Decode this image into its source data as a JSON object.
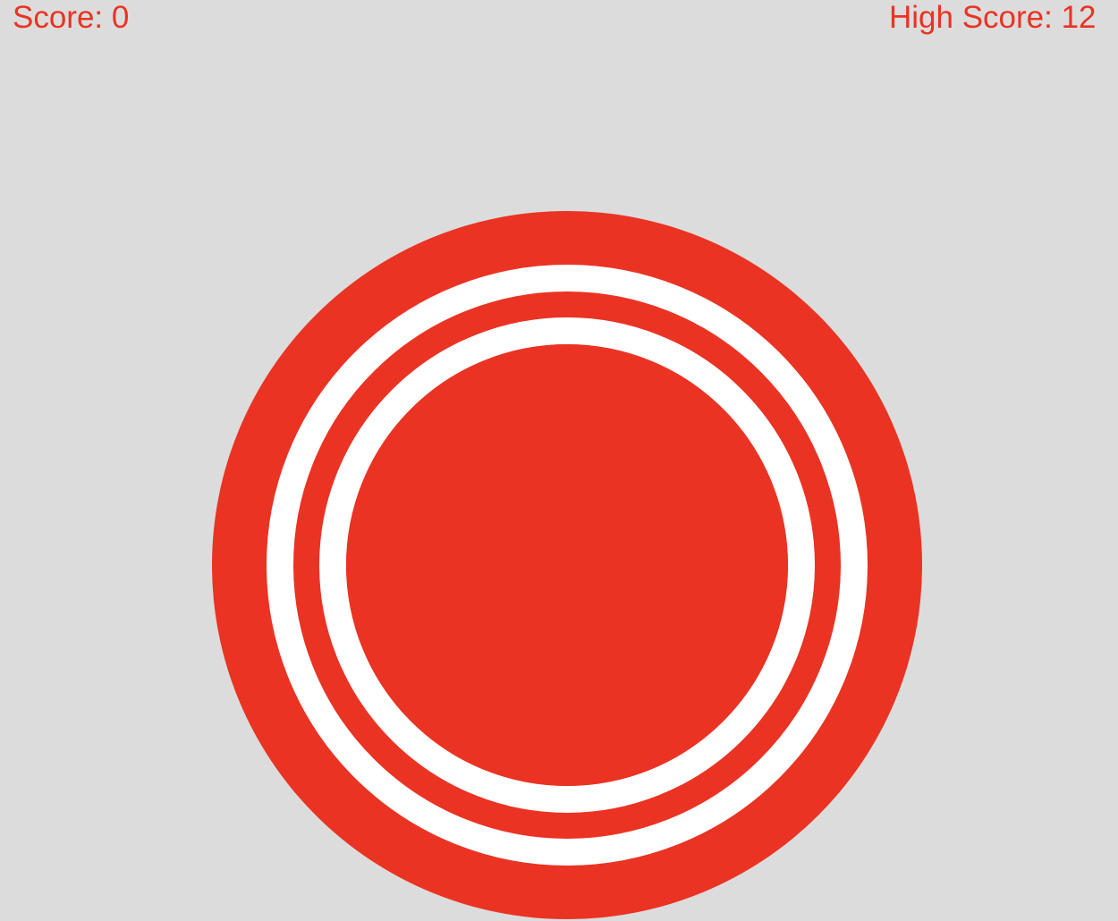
{
  "hud": {
    "score_label": "Score: 0",
    "high_score_label": "High Score: 12"
  },
  "colors": {
    "background": "#dcdcdc",
    "accent": "#ea3323",
    "ring": "#ffffff",
    "text": "#ea3323"
  },
  "target": {
    "icon": "bullseye-target"
  }
}
